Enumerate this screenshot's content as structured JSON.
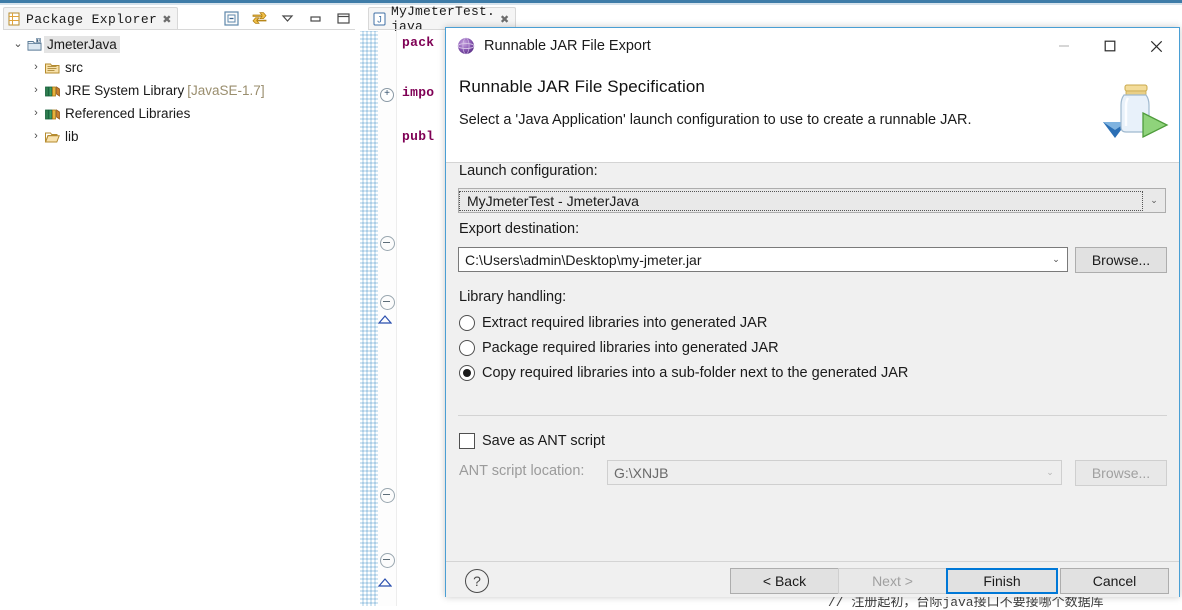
{
  "workbench": {
    "package_explorer": {
      "tab_label": "Package Explorer",
      "tab_close": "✖",
      "toolbar": [
        {
          "name": "collapse-all-icon",
          "label": "Collapse All"
        },
        {
          "name": "link-with-editor-icon",
          "label": "Link with Editor"
        },
        {
          "name": "view-menu-icon",
          "label": "View Menu"
        },
        {
          "name": "minimize-icon",
          "label": "Minimize"
        },
        {
          "name": "maximize-icon",
          "label": "Maximize"
        }
      ],
      "tree": [
        {
          "label": "JmeterJava",
          "suffix": "",
          "indent": 0,
          "twisty": "⌄",
          "icon": "java-project-icon",
          "selected": true
        },
        {
          "label": "src",
          "suffix": "",
          "indent": 1,
          "twisty": "›",
          "icon": "source-folder-icon",
          "selected": false
        },
        {
          "label": "JRE System Library ",
          "suffix": "[JavaSE-1.7]",
          "indent": 1,
          "twisty": "›",
          "icon": "library-icon",
          "selected": false
        },
        {
          "label": "Referenced Libraries",
          "suffix": "",
          "indent": 1,
          "twisty": "›",
          "icon": "library-icon",
          "selected": false
        },
        {
          "label": "lib",
          "suffix": "",
          "indent": 1,
          "twisty": "›",
          "icon": "folder-icon",
          "selected": false
        }
      ]
    },
    "editor": {
      "tab_label": "MyJmeterTest. java",
      "tab_close": "✖",
      "code_lines": [
        "pack",
        "impo",
        "publ"
      ],
      "comment_line": "// 注册起初，台际java接口不要接哪个数据库"
    }
  },
  "dialog": {
    "title": "Runnable JAR File Export",
    "app_icon": "export-jar-icon",
    "window_buttons": {
      "minimize": "—",
      "maximize": "□",
      "close": "✕"
    },
    "header": {
      "title": "Runnable JAR File Specification",
      "description": "Select a 'Java Application' launch configuration to use to create a runnable JAR.",
      "graphic": "runnable-jar-icon"
    },
    "launch_configuration": {
      "label": "Launch configuration:",
      "value": "MyJmeterTest - JmeterJava",
      "arrow": "⌄"
    },
    "export_destination": {
      "label": "Export destination:",
      "value": "C:\\Users\\admin\\Desktop\\my-jmeter.jar",
      "arrow": "⌄",
      "browse_label": "Browse..."
    },
    "library_handling": {
      "label": "Library handling:",
      "options": [
        {
          "label": "Extract required libraries into generated JAR",
          "checked": false
        },
        {
          "label": "Package required libraries into generated JAR",
          "checked": false
        },
        {
          "label": "Copy required libraries into a sub-folder next to the generated JAR",
          "checked": true
        }
      ]
    },
    "ant_script": {
      "checkbox_label": "Save as ANT script",
      "checked": false,
      "location_label": "ANT script location:",
      "location_value": "G:\\XNJB",
      "arrow": "⌄",
      "browse_label": "Browse...",
      "disabled": true
    },
    "footer": {
      "help_icon": "help-icon",
      "help_glyph": "?",
      "buttons": [
        {
          "name": "back-button",
          "label": "< Back",
          "state": "enabled"
        },
        {
          "name": "next-button",
          "label": "Next >",
          "state": "disabled"
        },
        {
          "name": "finish-button",
          "label": "Finish",
          "state": "default"
        },
        {
          "name": "cancel-button",
          "label": "Cancel",
          "state": "enabled"
        }
      ]
    }
  },
  "colors": {
    "accent_blue": "#0078d7",
    "selection_blue": "#1077d2",
    "dialog_bg": "#f0f0f0",
    "title_bar_blue": "#3e7ca8",
    "library_suffix": "#9a8e6e"
  }
}
